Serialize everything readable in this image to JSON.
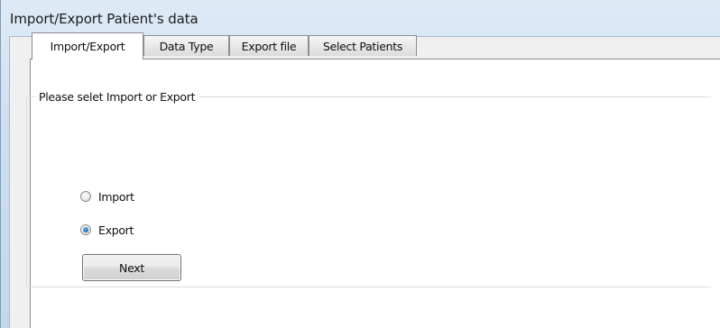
{
  "window": {
    "title": "Import/Export Patient's data"
  },
  "tabs": [
    {
      "label": "Import/Export",
      "active": true
    },
    {
      "label": "Data Type",
      "active": false
    },
    {
      "label": "Export file",
      "active": false
    },
    {
      "label": "Select Patients",
      "active": false
    }
  ],
  "group": {
    "legend": "Please selet Import or Export",
    "options": [
      {
        "label": "Import",
        "checked": false
      },
      {
        "label": "Export",
        "checked": true
      }
    ],
    "next_label": "Next"
  },
  "colors": {
    "title_bar": "#dfeaf7",
    "panel_background": "#ffffff",
    "radio_selected": "#1f68b8"
  }
}
